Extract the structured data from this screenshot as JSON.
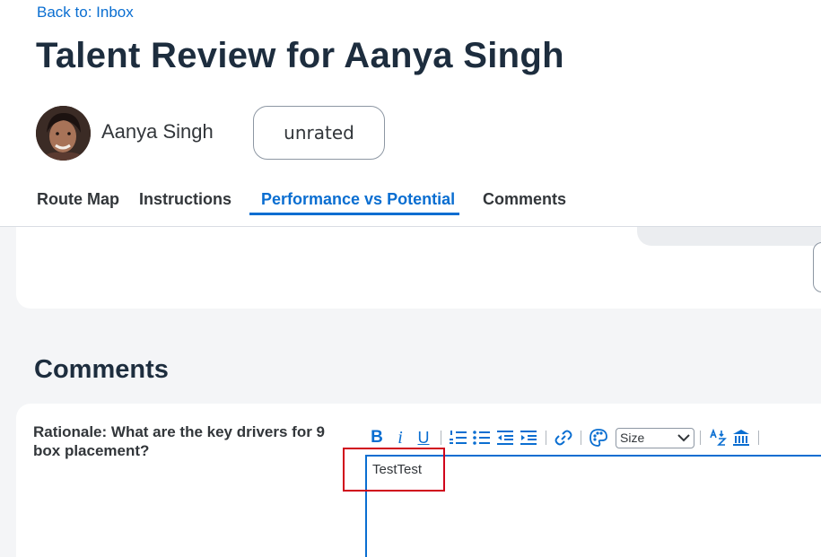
{
  "header": {
    "back_link": "Back to: Inbox",
    "title": "Talent Review for Aanya Singh",
    "person_name": "Aanya Singh",
    "rating": "unrated"
  },
  "tabs": [
    {
      "label": "Route Map",
      "active": false
    },
    {
      "label": "Instructions",
      "active": false
    },
    {
      "label": "Performance vs Potential",
      "active": true
    },
    {
      "label": "Comments",
      "active": false
    }
  ],
  "comments_section": {
    "title": "Comments",
    "question": "Rationale: What are the key drivers for 9 box placement?",
    "toolbar": {
      "bold_label": "B",
      "italic_label": "i",
      "underline_label": "U",
      "size_label": "Size"
    },
    "editor_value": "TestTest"
  },
  "colors": {
    "accent": "#0a6ed1",
    "title_text": "#1d2d3e",
    "highlight": "#d0021b",
    "page_bg": "#f4f5f7"
  }
}
